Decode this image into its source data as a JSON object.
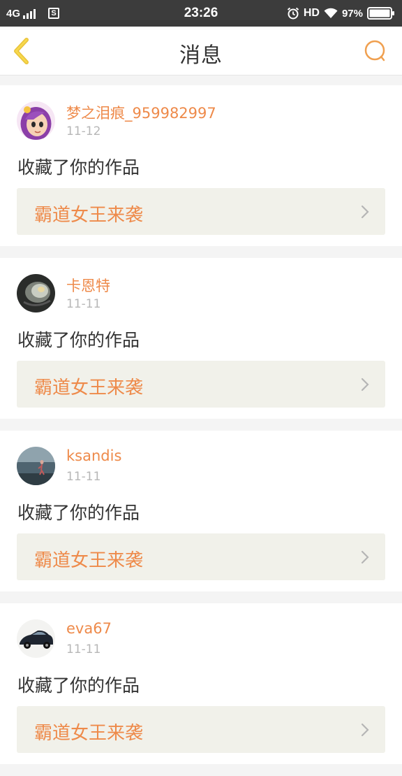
{
  "status_bar": {
    "network": "4G",
    "sim_label": "S",
    "time": "23:26",
    "hd_label": "HD",
    "battery": "97%",
    "icons": [
      "signal-icon",
      "alarm-icon",
      "wifi-icon",
      "battery-icon"
    ]
  },
  "header": {
    "title": "消息",
    "back_icon": "chevron-left-icon",
    "search_icon": "search-icon",
    "accent_color": "#f0a050"
  },
  "messages": [
    {
      "username": "梦之泪痕_959982997",
      "date": "11-12",
      "action": "收藏了你的作品",
      "work_title": "霸道女王来袭"
    },
    {
      "username": "卡恩特",
      "date": "11-11",
      "action": "收藏了你的作品",
      "work_title": "霸道女王来袭"
    },
    {
      "username": "ksandis",
      "date": "11-11",
      "action": "收藏了你的作品",
      "work_title": "霸道女王来袭"
    },
    {
      "username": "eva67",
      "date": "11-11",
      "action": "收藏了你的作品",
      "work_title": "霸道女王来袭"
    }
  ],
  "colors": {
    "accent": "#ee8a4a",
    "link_background": "#f1f1ea",
    "date_text": "#b7b7b7",
    "status_bar": "#3c3c3c"
  }
}
